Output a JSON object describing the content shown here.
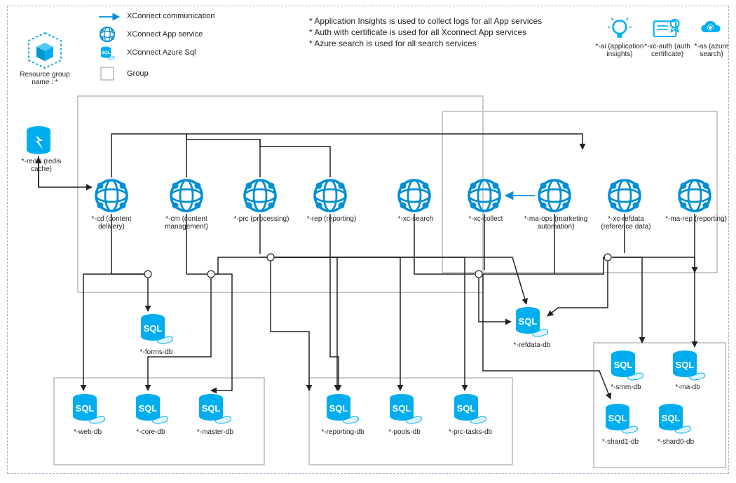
{
  "resource_group_label": "Resource group name : *",
  "legend": {
    "comm": "XConnect communication",
    "app": "XConnect App service",
    "sql": "XConnect Azure Sql",
    "group": "Group"
  },
  "notes": {
    "l1": "* Application Insights is used to collect logs for all App services",
    "l2": "* Auth with certificate is used for all Xconnect App services",
    "l3": "* Azure search is used for all search services"
  },
  "top_right": {
    "ai": "*-ai (application insights)",
    "auth": "*-xc-auth (auth certificate)",
    "as": "*-as (azure search)"
  },
  "redis_label": "*-redis (redis cache)",
  "apps": {
    "cd": "*-cd (content delivery)",
    "cm": "*-cm (content management)",
    "prc": "*-prc (processing)",
    "rep": "*-rep (reporting)",
    "xc_search": "*-xc-search",
    "xc_collect": "*-xc-collect",
    "ma_ops": "*-ma-ops (marketing automation)",
    "xc_refdata": "*-xc-refdata (reference data)",
    "ma_rep": "*-ma-rep (reporting)"
  },
  "dbs": {
    "forms": "*-forms-db",
    "refdata": "*-refdata-db",
    "web": "*-web-db",
    "core": "*-core-db",
    "master": "*-master-db",
    "reporting": "*-reporting-db",
    "pools": "*-pools-db",
    "prc_tasks": "*-prc-tasks-db",
    "smm": "*-smm-db",
    "ma": "*-ma-db",
    "shard1": "*-shard1-db",
    "shard0": "*-shard0-db"
  }
}
